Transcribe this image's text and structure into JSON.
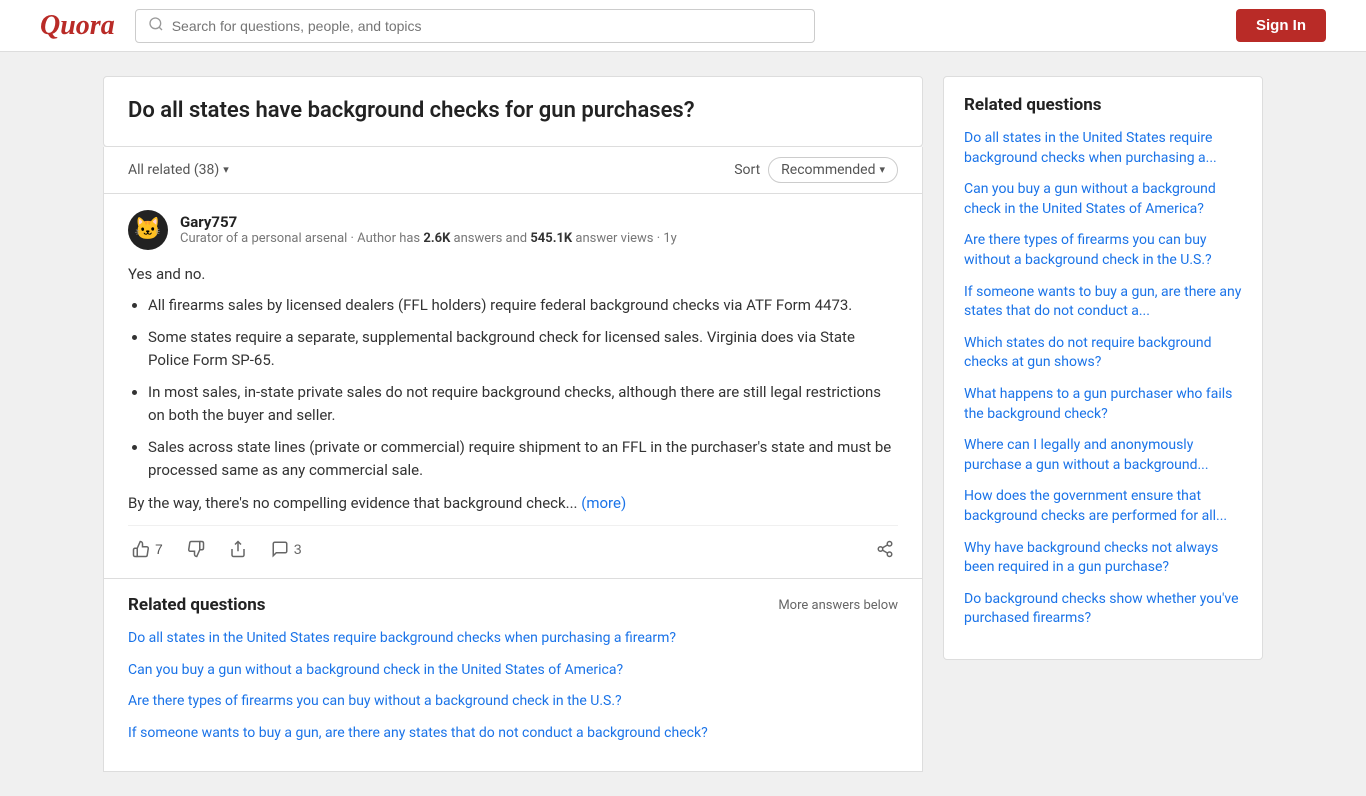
{
  "header": {
    "logo": "Quora",
    "search_placeholder": "Search for questions, people, and topics",
    "sign_in_label": "Sign In"
  },
  "question": {
    "title": "Do all states have background checks for gun purchases?"
  },
  "sort_bar": {
    "all_related_label": "All related (38)",
    "sort_label": "Sort",
    "sort_option": "Recommended",
    "chevron": "▾"
  },
  "answer": {
    "author_name": "Gary757",
    "author_meta_prefix": "Curator of a personal arsenal · Author has ",
    "answers_count": "2.6K",
    "answers_label": " answers and ",
    "views_count": "545.1K",
    "views_label": " answer views · 1y",
    "intro": "Yes and no.",
    "bullet1": "All firearms sales by licensed dealers (FFL holders) require federal background checks via ATF Form 4473.",
    "bullet2": "Some states require a separate, supplemental background check for licensed sales. Virginia does via State Police Form SP-65.",
    "bullet3": "In most sales, in-state private sales do not require background checks, although there are still legal restrictions on both the buyer and seller.",
    "bullet4": "Sales across state lines (private or commercial) require shipment to an FFL in the purchaser's state and must be processed same as any commercial sale.",
    "outro": "By the way, there's no compelling evidence that background check...",
    "more_label": "(more)",
    "upvote_count": "7",
    "comment_count": "3"
  },
  "related_in_main": {
    "title": "Related questions",
    "more_answers": "More answers below",
    "links": [
      "Do all states in the United States require background checks when purchasing a firearm?",
      "Can you buy a gun without a background check in the United States of America?",
      "Are there types of firearms you can buy without a background check in the U.S.?",
      "If someone wants to buy a gun, are there any states that do not conduct a background check?"
    ]
  },
  "sidebar": {
    "title": "Related questions",
    "links": [
      "Do all states in the United States require background checks when purchasing a...",
      "Can you buy a gun without a background check in the United States of America?",
      "Are there types of firearms you can buy without a background check in the U.S.?",
      "If someone wants to buy a gun, are there any states that do not conduct a...",
      "Which states do not require background checks at gun shows?",
      "What happens to a gun purchaser who fails the background check?",
      "Where can I legally and anonymously purchase a gun without a background...",
      "How does the government ensure that background checks are performed for all...",
      "Why have background checks not always been required in a gun purchase?",
      "Do background checks show whether you've purchased firearms?"
    ]
  }
}
